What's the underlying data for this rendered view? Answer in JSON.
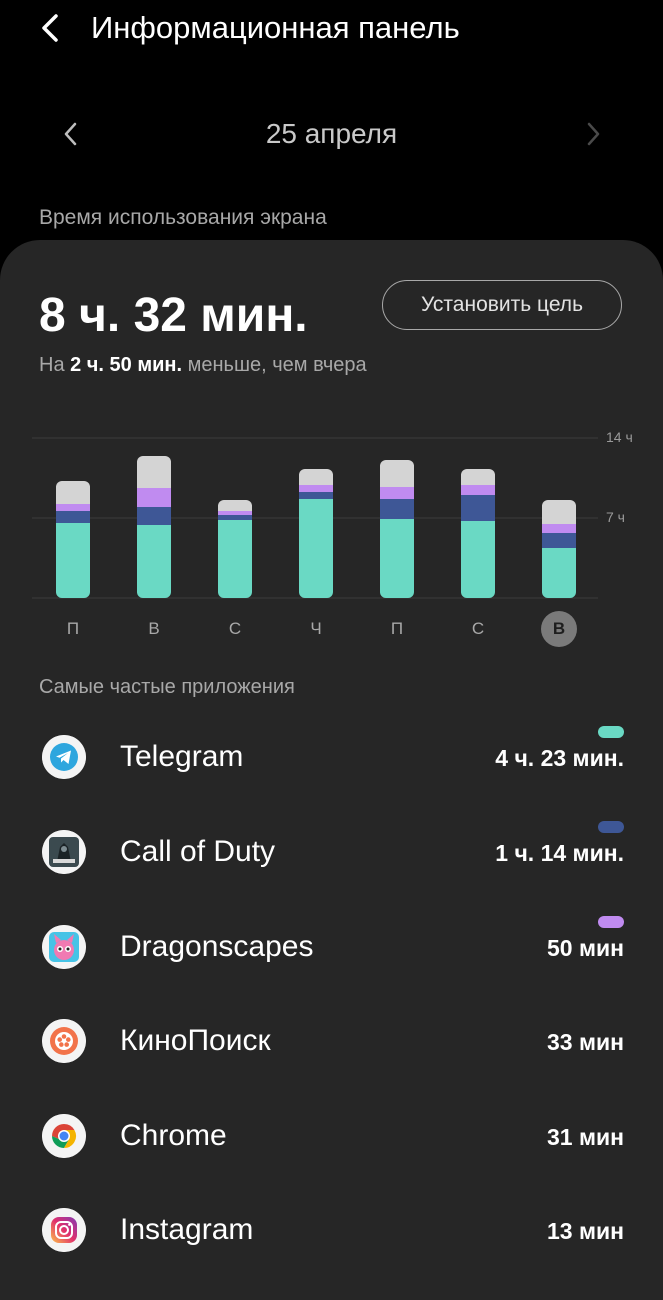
{
  "header": {
    "title": "Информационная панель"
  },
  "date_nav": {
    "date": "25 апреля"
  },
  "section_label": "Время использования экрана",
  "summary": {
    "total": "8 ч. 32 мин.",
    "goal_button": "Установить цель",
    "compare_prefix": "На ",
    "compare_bold": "2 ч. 50 мин.",
    "compare_suffix": " меньше, чем вчера"
  },
  "chart_data": {
    "type": "bar",
    "stacked": true,
    "categories": [
      "П",
      "В",
      "С",
      "Ч",
      "П",
      "С",
      "В"
    ],
    "selected_index": 6,
    "y_ticks": [
      "7 ч",
      "14 ч"
    ],
    "ylim": [
      0,
      14
    ],
    "series": [
      {
        "color": "#6ad9c4",
        "values": [
          6.6,
          6.4,
          6.8,
          8.7,
          6.9,
          6.7,
          4.4
        ]
      },
      {
        "color": "#3e5796",
        "values": [
          1.0,
          1.6,
          0.5,
          0.6,
          1.8,
          2.3,
          1.3
        ]
      },
      {
        "color": "#c08bf0",
        "values": [
          0.6,
          1.6,
          0.3,
          0.6,
          1.0,
          0.9,
          0.8
        ]
      },
      {
        "color": "#d4d4d4",
        "values": [
          2.0,
          2.8,
          1.0,
          1.4,
          2.4,
          1.4,
          2.1
        ]
      }
    ]
  },
  "apps_label": "Самые частые приложения",
  "apps": [
    {
      "name": "Telegram",
      "time": "4 ч. 23 мин.",
      "color": "#6ad9c4",
      "icon": "telegram-icon"
    },
    {
      "name": "Call of Duty",
      "time": "1 ч. 14 мин.",
      "color": "#3e5796",
      "icon": "call-of-duty-icon"
    },
    {
      "name": "Dragonscapes",
      "time": "50 мин",
      "color": "#c08bf0",
      "icon": "dragonscapes-icon"
    },
    {
      "name": "КиноПоиск",
      "time": "33 мин",
      "color": "",
      "icon": "kinopoisk-icon"
    },
    {
      "name": "Chrome",
      "time": "31 мин",
      "color": "",
      "icon": "chrome-icon"
    },
    {
      "name": "Instagram",
      "time": "13 мин",
      "color": "",
      "icon": "instagram-icon"
    }
  ]
}
